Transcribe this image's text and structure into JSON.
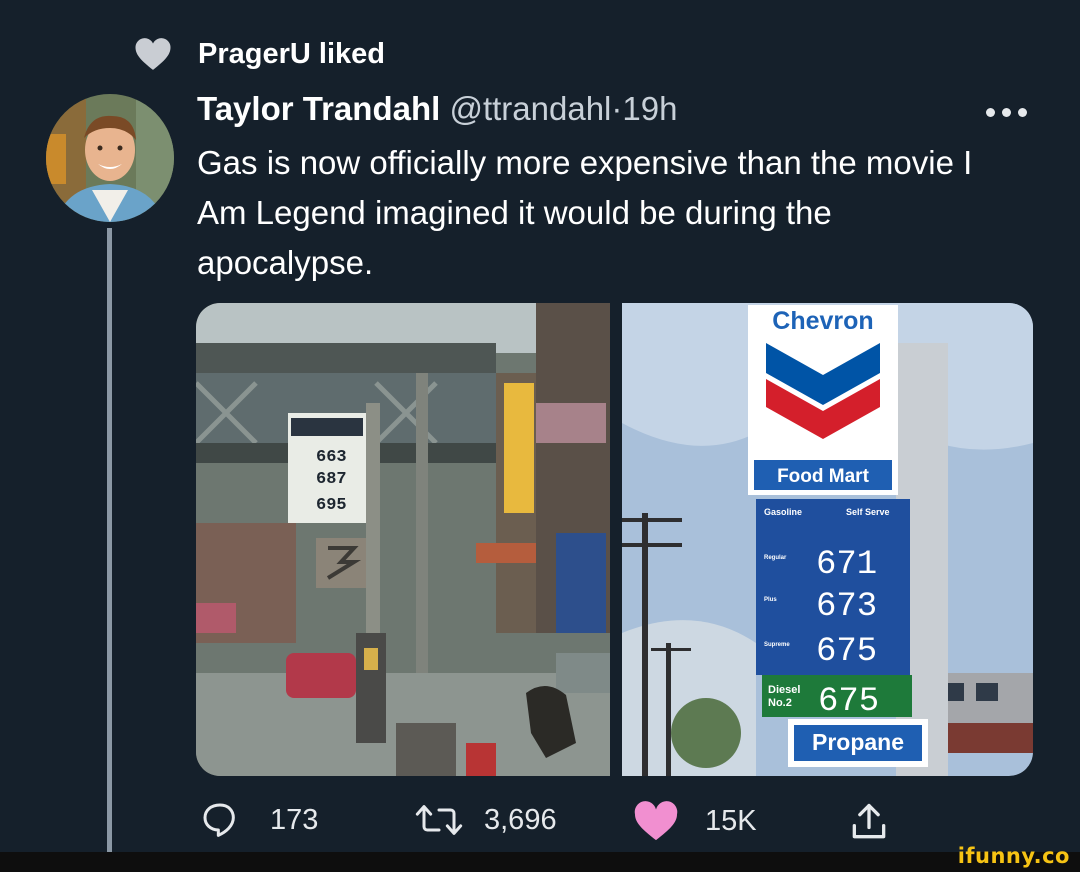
{
  "activity": {
    "text": "PragerU liked",
    "icon": "heart-icon"
  },
  "tweet": {
    "author_name": "Taylor Trandahl",
    "handle": "@ttrandahl",
    "separator": "·",
    "time": "19h",
    "text": "Gas is now officially more expensive than the movie I Am Legend imagined it would be during the apocalypse."
  },
  "media": {
    "left_sign": {
      "prices": [
        "663",
        "687",
        "695"
      ]
    },
    "right_sign": {
      "brand": "Chevron",
      "food_mart": "Food Mart",
      "header_left": "Gasoline",
      "header_right": "Self Serve",
      "grades": [
        {
          "label": "Regular",
          "price": "671"
        },
        {
          "label": "Plus",
          "price": "673"
        },
        {
          "label": "Supreme",
          "price": "675"
        }
      ],
      "diesel_label_1": "Diesel",
      "diesel_label_2": "No.2",
      "diesel_price": "675",
      "propane": "Propane"
    }
  },
  "actions": {
    "reply_count": "173",
    "retweet_count": "3,696",
    "like_count": "15K",
    "like_color": "#f18fd0"
  },
  "watermark": "ifunny.co"
}
